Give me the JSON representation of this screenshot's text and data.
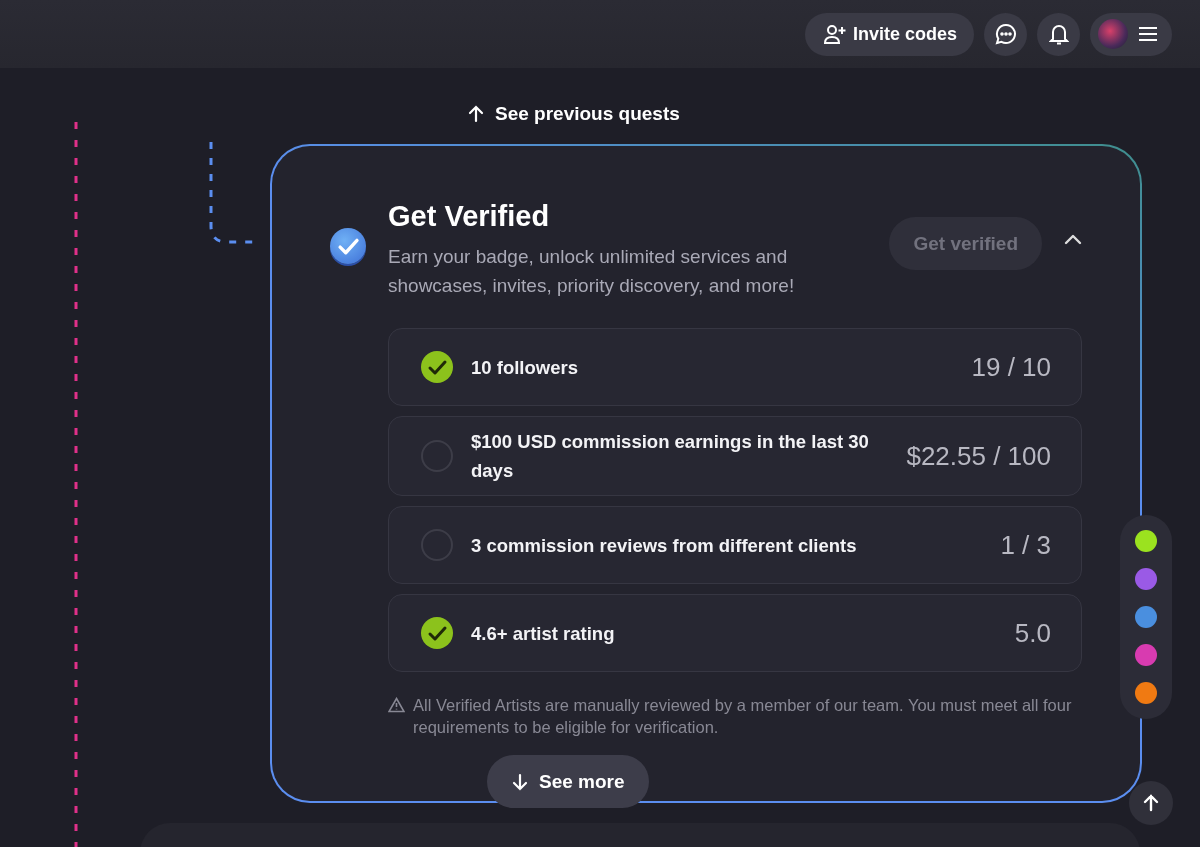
{
  "header": {
    "invite_button": "Invite codes"
  },
  "previous_link": "See previous quests",
  "quest": {
    "title": "Get Verified",
    "description": "Earn your badge, unlock unlimited services and showcases, invites, priority discovery, and more!",
    "action_button": {
      "label": "Get verified",
      "disabled": true
    },
    "expanded": true,
    "requirements": [
      {
        "label": "10 followers",
        "progress": "19 / 10",
        "completed": true
      },
      {
        "label": "$100 USD commission earnings in the last 30 days",
        "progress": "$22.55 / 100",
        "completed": false
      },
      {
        "label": "3 commission reviews from different clients",
        "progress": "1 / 3",
        "completed": false
      },
      {
        "label": "4.6+ artist rating",
        "progress": "5.0",
        "completed": true
      }
    ],
    "note": "All Verified Artists are manually reviewed by a member of our team. You must meet all four requirements to be eligible for verification.",
    "see_more_button": "See more"
  },
  "quest_rail": [
    {
      "color": "#9be21f"
    },
    {
      "color": "#9a5ae6"
    },
    {
      "color": "#4a8fdf"
    },
    {
      "color": "#d83bb0"
    },
    {
      "color": "#f07a12"
    }
  ]
}
